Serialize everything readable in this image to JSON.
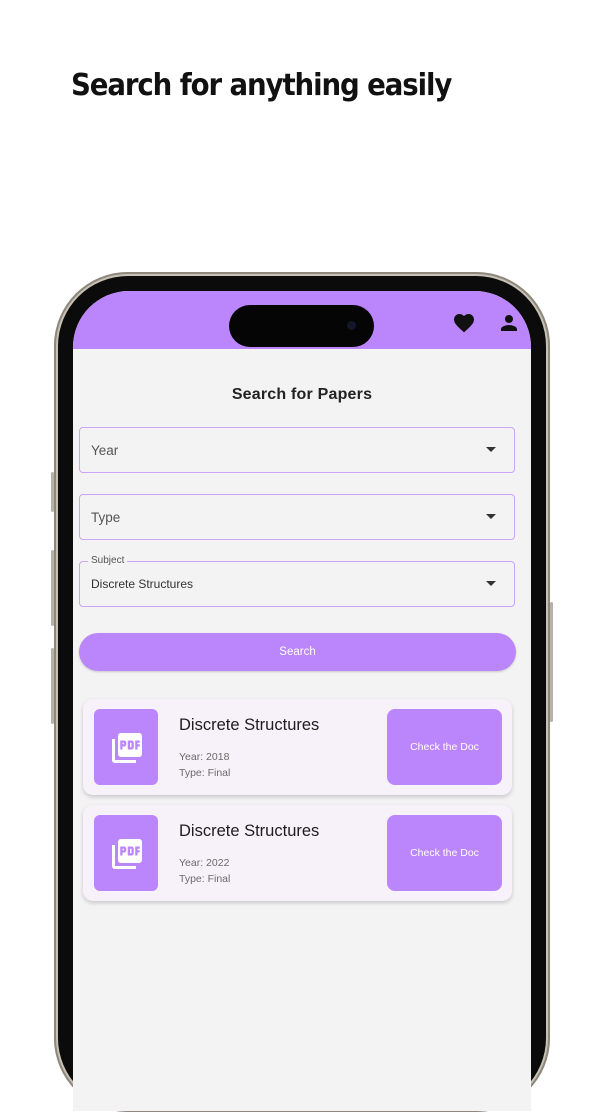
{
  "promo": {
    "headline": "Search for anything easily"
  },
  "app": {
    "title": "Search for Papers",
    "accent_color": "#bb86fc",
    "appbar_icons": [
      "favorite-heart-icon",
      "person-icon"
    ],
    "filters": {
      "year": {
        "placeholder": "Year"
      },
      "type": {
        "placeholder": "Type"
      },
      "subject": {
        "label": "Subject",
        "value": "Discrete Structures"
      }
    },
    "search_label": "Search",
    "results": [
      {
        "title": "Discrete Structures",
        "year": "Year: 2018",
        "type": "Type: Final",
        "action": "Check the Doc"
      },
      {
        "title": "Discrete Structures",
        "year": "Year: 2022",
        "type": "Type: Final",
        "action": "Check the Doc"
      }
    ]
  }
}
